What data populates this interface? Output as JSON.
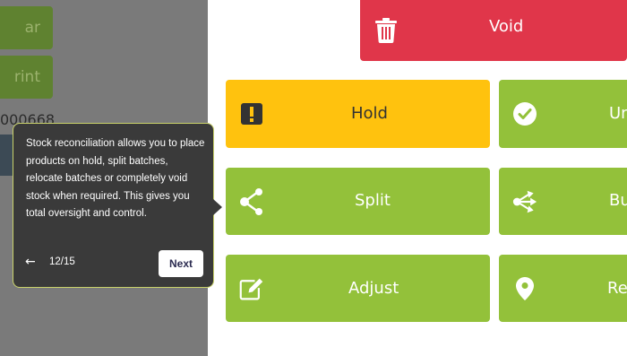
{
  "left": {
    "button1_label": "ar",
    "button2_label": "rint",
    "ref": "000668"
  },
  "tiles": {
    "void": {
      "label": "Void",
      "icon": "trash-icon",
      "color": "#e0364a"
    },
    "hold": {
      "label": "Hold",
      "icon": "exclamation-icon",
      "color": "#ffc20e"
    },
    "unhold": {
      "label": "Un",
      "icon": "check-circle-icon",
      "color": "#93c13a"
    },
    "split": {
      "label": "Split",
      "icon": "split-icon",
      "color": "#93c13a"
    },
    "bulk": {
      "label": "Bu",
      "icon": "merge-icon",
      "color": "#93c13a"
    },
    "adjust": {
      "label": "Adjust",
      "icon": "edit-icon",
      "color": "#93c13a"
    },
    "relocate": {
      "label": "Re",
      "icon": "location-pin-icon",
      "color": "#93c13a"
    }
  },
  "tooltip": {
    "text": "Stock reconciliation allows you to place products on hold, split batches, relocate batches or completely void stock when required. This gives you total oversight and control.",
    "back_icon": "←",
    "step_counter": "12/15",
    "next_label": "Next"
  }
}
